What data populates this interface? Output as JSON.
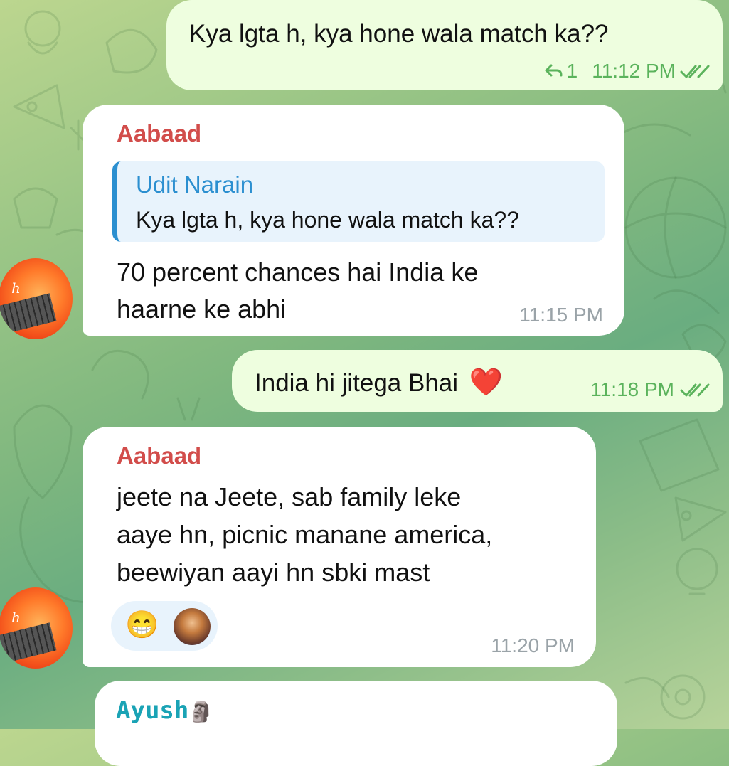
{
  "messages": [
    {
      "direction": "outgoing",
      "text": "Kya lgta h, kya hone wala match ka??",
      "reply_count": "1",
      "time": "11:12 PM",
      "status": "read"
    },
    {
      "direction": "incoming",
      "sender": "Aabaad",
      "quote": {
        "author": "Udit Narain",
        "text": "Kya lgta h, kya hone wala match ka??"
      },
      "text_lines": [
        "70 percent chances hai India ke",
        "haarne ke abhi"
      ],
      "time": "11:15 PM"
    },
    {
      "direction": "outgoing",
      "text": "India hi jitega Bhai",
      "emoji": "❤️",
      "time": "11:18 PM",
      "status": "read"
    },
    {
      "direction": "incoming",
      "sender": "Aabaad",
      "text_lines": [
        "jeete na Jeete, sab family leke",
        "aaye hn, picnic manane america,",
        "beewiyan aayi hn sbki mast"
      ],
      "reaction": "😁",
      "time": "11:20 PM"
    },
    {
      "direction": "incoming",
      "sender": "Ayush",
      "sender_emoji": "🗿"
    }
  ],
  "colors": {
    "sender_red": "#d24d4b",
    "quote_author_blue": "#2b8fd0",
    "quote_bar_blue": "#2b8fd0",
    "ayush_teal": "#1aa3b5",
    "read_green": "#5bb35c",
    "outgoing_bubble": "#eefedf",
    "incoming_bubble": "#ffffff"
  },
  "icons": {
    "reply": "reply-arrow-icon",
    "read": "double-check-icon",
    "avatar": "user-avatar"
  }
}
